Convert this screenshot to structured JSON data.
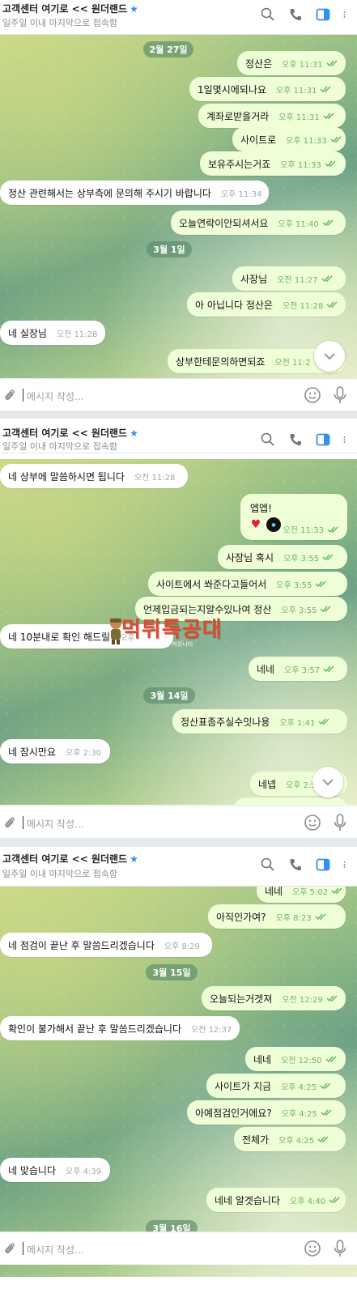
{
  "header": {
    "title": "고객센터 여기로 << 원더랜드",
    "star": "★",
    "status": "일주일 이내 마지막으로 접속함"
  },
  "composer": {
    "placeholder": "메시지 작성..."
  },
  "panel1": {
    "dates": [
      "2월 27일",
      "3월 1일"
    ],
    "messages": [
      {
        "text": "정산은",
        "time": "오후 11:31"
      },
      {
        "text": "1일몇시에되나요",
        "time": "오후 11:31"
      },
      {
        "text": "계좌로받을거라",
        "time": "오후 11:31"
      },
      {
        "text": "사이트로",
        "time": "오후 11:33"
      },
      {
        "text": "보유주시는거죠",
        "time": "오후 11:33"
      },
      {
        "text": "정산 관련해서는 상부측에 문의해 주시기 바랍니다",
        "time": "오후 11:34"
      },
      {
        "text": "오늘연락이안되셔서요",
        "time": "오후 11:40"
      },
      {
        "text": "사장님",
        "time": "오전 11:27"
      },
      {
        "text": "아 아닙니다 정산은",
        "time": "오전 11:28"
      },
      {
        "text": "네 실장님",
        "time": "오전 11:28"
      },
      {
        "text": "상부한테문의하면되죠",
        "time": "오전 11:2"
      }
    ]
  },
  "panel2": {
    "dates": [
      "3월 14일"
    ],
    "messages": [
      {
        "text": "네 상부에 말씀하시면 됩니다",
        "time": "오전 11:28"
      },
      {
        "text": "엡엡!",
        "time": "오전 11:33"
      },
      {
        "text": "사장님 혹시",
        "time": "오후 3:55"
      },
      {
        "text": "사이트에서 쏴준다고들어서",
        "time": "오후 3:55"
      },
      {
        "text": "언제입금되는지알수있나여 정산",
        "time": "오후 3:55"
      },
      {
        "text": "네 10분내로 확인 해드릴",
        "time": "오후"
      },
      {
        "text": "네네",
        "time": "오후 3:57"
      },
      {
        "text": "정산표좀주실수잇나용",
        "time": "오후 1:41"
      },
      {
        "text": "네 잠시만요",
        "time": "오후 2:30"
      },
      {
        "text": "네넵",
        "time": "오후 2:5"
      }
    ],
    "watermark": {
      "main": "먹튀특공대",
      "sub": "국내 최대 먹튀 검증 커뮤니티"
    }
  },
  "panel3": {
    "dates": [
      "3월 15일",
      "3월 16일"
    ],
    "messages": [
      {
        "text": "네네",
        "time": "오후 5:02"
      },
      {
        "text": "아직인가여?",
        "time": "오후 8:23"
      },
      {
        "text": "네 점검이 끝난 후 말씀드리겠습니다",
        "time": "오후 8:29"
      },
      {
        "text": "오늘되는거겟져",
        "time": "오전 12:29"
      },
      {
        "text": "확인이 불가해서 끝난 후 말씀드리겠습니다",
        "time": "오전 12:37"
      },
      {
        "text": "네네",
        "time": "오전 12:50"
      },
      {
        "text": "사이트가 지금",
        "time": "오후 4:25"
      },
      {
        "text": "아예점검인거에요?",
        "time": "오후 4:25"
      },
      {
        "text": "전체가",
        "time": "오후 4:25"
      },
      {
        "text": "네 맞습니다",
        "time": "오후 4:39"
      },
      {
        "text": "네네 알겟습니다",
        "time": "오후 4:40"
      }
    ]
  }
}
